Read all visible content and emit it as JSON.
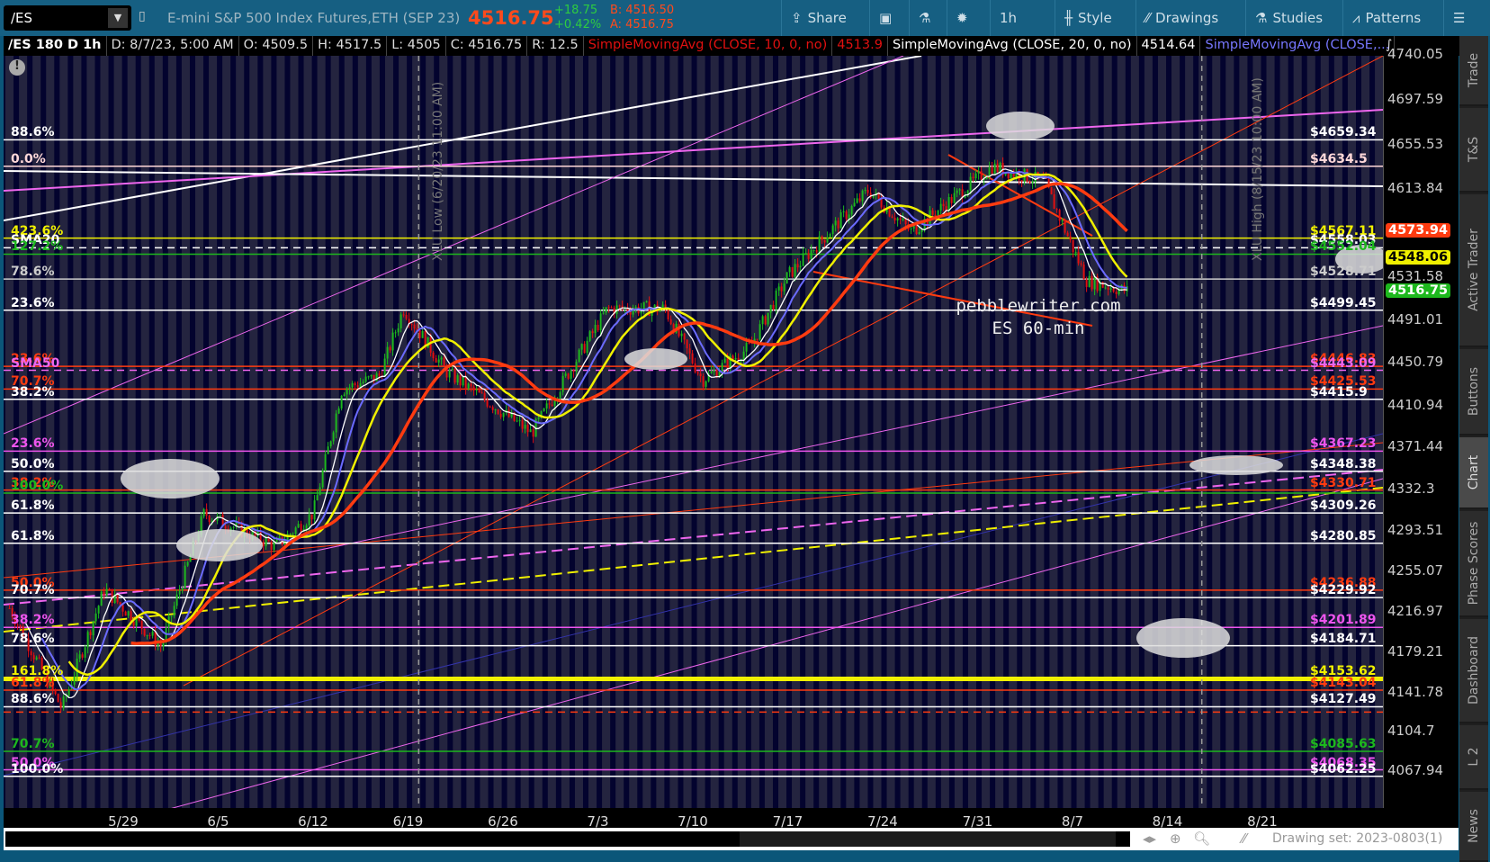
{
  "toolbar": {
    "symbol": "/ES",
    "description": "E-mini S&P 500 Index Futures,ETH (SEP 23)",
    "last": "4516.75",
    "change": "+18.75",
    "change_pct": "+0.42%",
    "bid": "B: 4516.50",
    "ask": "A: 4516.75",
    "buttons": [
      {
        "label": "Share",
        "icon": "share-icon"
      },
      {
        "label": "",
        "icon": "alert-icon"
      },
      {
        "label": "",
        "icon": "flask-icon"
      },
      {
        "label": "",
        "icon": "gear-icon"
      },
      {
        "label": "1h",
        "icon": ""
      },
      {
        "label": "Style",
        "icon": "candle-icon"
      },
      {
        "label": "Drawings",
        "icon": "pencil-icon"
      },
      {
        "label": "Studies",
        "icon": "flask-icon"
      },
      {
        "label": "Patterns",
        "icon": "patterns-icon"
      },
      {
        "label": "",
        "icon": "menu-icon"
      }
    ]
  },
  "infobar": {
    "title": "/ES 180 D 1h",
    "date": "D: 8/7/23, 5:00 AM",
    "open": "O: 4509.5",
    "high": "H: 4517.5",
    "low": "L: 4505",
    "close": "C: 4516.75",
    "range": "R: 12.5",
    "sma10": "SimpleMovingAvg (CLOSE, 10, 0, no)",
    "sma10_val": "4513.9",
    "sma20": "SimpleMovingAvg (CLOSE, 20, 0, no)",
    "sma20_val": "4514.64",
    "sma50": "SimpleMovingAvg (CLOSE,..."
  },
  "axis": {
    "ticks": [
      "4740.05",
      "4697.59",
      "4655.53",
      "4613.84",
      "4531.58",
      "4491.01",
      "4450.79",
      "4410.94",
      "4371.44",
      "4332.3",
      "4293.51",
      "4255.07",
      "4216.97",
      "4179.21",
      "4141.78",
      "4104.7",
      "4067.94"
    ],
    "badges": [
      {
        "value": "4573.94",
        "bg": "#ff3b10",
        "fg": "#fff"
      },
      {
        "value": "4548.06",
        "bg": "#f0f000",
        "fg": "#000"
      },
      {
        "value": "4516.75",
        "bg": "#1db81d",
        "fg": "#fff"
      }
    ]
  },
  "dates": [
    "5/29",
    "6/5",
    "6/12",
    "6/19",
    "6/26",
    "7/3",
    "7/10",
    "7/17",
    "7/24",
    "7/31",
    "8/7",
    "8/14",
    "8/21"
  ],
  "tabs": [
    "Trade",
    "T&S",
    "Active Trader",
    "Buttons",
    "Chart",
    "Phase Scores",
    "Dashboard",
    "L 2",
    "News"
  ],
  "watermark": {
    "line1": "pebblewriter.com",
    "line2": "ES 60-min"
  },
  "vlines": [
    {
      "label": "XLU Low (6/20/23 11:00 AM)",
      "week": 3.15
    },
    {
      "label": "XLU High (8/15/23 10:00 AM)",
      "week": 11.4
    }
  ],
  "scroll": {
    "drawing_set": "Drawing set: 2023-0803(1)"
  },
  "chart_data": {
    "type": "candlestick",
    "title": "/ES 180 D 1h",
    "ylim": [
      4040,
      4745
    ],
    "x_unit": "weeks from 5/29",
    "path": [
      [
        -1.16,
        4220
      ],
      [
        -0.61,
        4126
      ],
      [
        -0.16,
        4238
      ],
      [
        0.44,
        4184
      ],
      [
        0.89,
        4309
      ],
      [
        1.64,
        4278
      ],
      [
        2.04,
        4309
      ],
      [
        2.34,
        4425
      ],
      [
        2.74,
        4438
      ],
      [
        2.99,
        4501
      ],
      [
        3.44,
        4442
      ],
      [
        4.34,
        4384
      ],
      [
        5.14,
        4501
      ],
      [
        5.74,
        4501
      ],
      [
        6.14,
        4434
      ],
      [
        6.64,
        4465
      ],
      [
        7.04,
        4532
      ],
      [
        7.89,
        4612
      ],
      [
        8.34,
        4573
      ],
      [
        9.19,
        4634
      ],
      [
        9.74,
        4620
      ],
      [
        10.19,
        4527
      ],
      [
        10.64,
        4516.75
      ]
    ],
    "levels": [
      {
        "price": 4659.34,
        "label": "88.6%",
        "tag": "$4659.34",
        "color": "#ffffff"
      },
      {
        "price": 4634.5,
        "label": "0.0%",
        "tag": "$4634.5",
        "color": "#ffd8d8"
      },
      {
        "price": 4567.11,
        "label": "423.6%",
        "tag": "$4567.11",
        "color": "#f0f000"
      },
      {
        "price": 4558.03,
        "label": "SMA20",
        "tag": "$4558.03",
        "color": "#ffffff",
        "dash": true
      },
      {
        "price": 4552.04,
        "label": "127.2%",
        "tag": "$4552.04",
        "color": "#1db81d"
      },
      {
        "price": 4528.71,
        "label": "78.6%",
        "tag": "$4528.71",
        "color": "#cccccc"
      },
      {
        "price": 4499.45,
        "label": "23.6%",
        "tag": "$4499.45",
        "color": "#ffffff"
      },
      {
        "price": 4446.83,
        "label": "23.6%",
        "tag": "$4446.83",
        "color": "#ff3b10"
      },
      {
        "price": 4443.09,
        "label": "SMA50",
        "tag": "$4443.09",
        "color": "#ee66ee",
        "dash": true
      },
      {
        "price": 4425.53,
        "label": "70.7%",
        "tag": "$4425.53",
        "color": "#ff3b10"
      },
      {
        "price": 4415.9,
        "label": "38.2%",
        "tag": "$4415.9",
        "color": "#ffffff"
      },
      {
        "price": 4367.23,
        "label": "23.6%",
        "tag": "$4367.23",
        "color": "#ee55ee"
      },
      {
        "price": 4348.38,
        "label": "50.0%",
        "tag": "$4348.38",
        "color": "#ffffff"
      },
      {
        "price": 4330.71,
        "label": "38.2%",
        "tag": "$4330.71",
        "color": "#ff3b10"
      },
      {
        "price": 4327.9,
        "label": "100.0%",
        "tag": "",
        "color": "#1db81d"
      },
      {
        "price": 4309.26,
        "label": "61.8%",
        "tag": "$4309.26",
        "color": "#ffffff"
      },
      {
        "price": 4280.85,
        "label": "61.8%",
        "tag": "$4280.85",
        "color": "#ffffff"
      },
      {
        "price": 4236.88,
        "label": "50.0%",
        "tag": "$4236.88",
        "color": "#ff3b10"
      },
      {
        "price": 4229.92,
        "label": "70.7%",
        "tag": "$4229.92",
        "color": "#ffffff"
      },
      {
        "price": 4201.89,
        "label": "38.2%",
        "tag": "$4201.89",
        "color": "#ee55ee"
      },
      {
        "price": 4184.71,
        "label": "78.6%",
        "tag": "$4184.71",
        "color": "#ffffff"
      },
      {
        "price": 4153.62,
        "label": "161.8%",
        "tag": "$4153.62",
        "color": "#f0f000",
        "thick": true
      },
      {
        "price": 4143.04,
        "label": "61.8%",
        "tag": "$4143.04",
        "color": "#ff3b10"
      },
      {
        "price": 4127.49,
        "label": "88.6%",
        "tag": "$4127.49",
        "color": "#ffffff"
      },
      {
        "price": 4122.49,
        "label": "",
        "tag": "",
        "color": "#ff3b10",
        "dash": true
      },
      {
        "price": 4085.63,
        "label": "70.7%",
        "tag": "$4085.63",
        "color": "#1db81d"
      },
      {
        "price": 4068.35,
        "label": "50.0%",
        "tag": "$4068.35",
        "color": "#ee55ee"
      },
      {
        "price": 4062.25,
        "label": "100.0%",
        "tag": "$4062.25",
        "color": "#ffffff"
      }
    ]
  }
}
